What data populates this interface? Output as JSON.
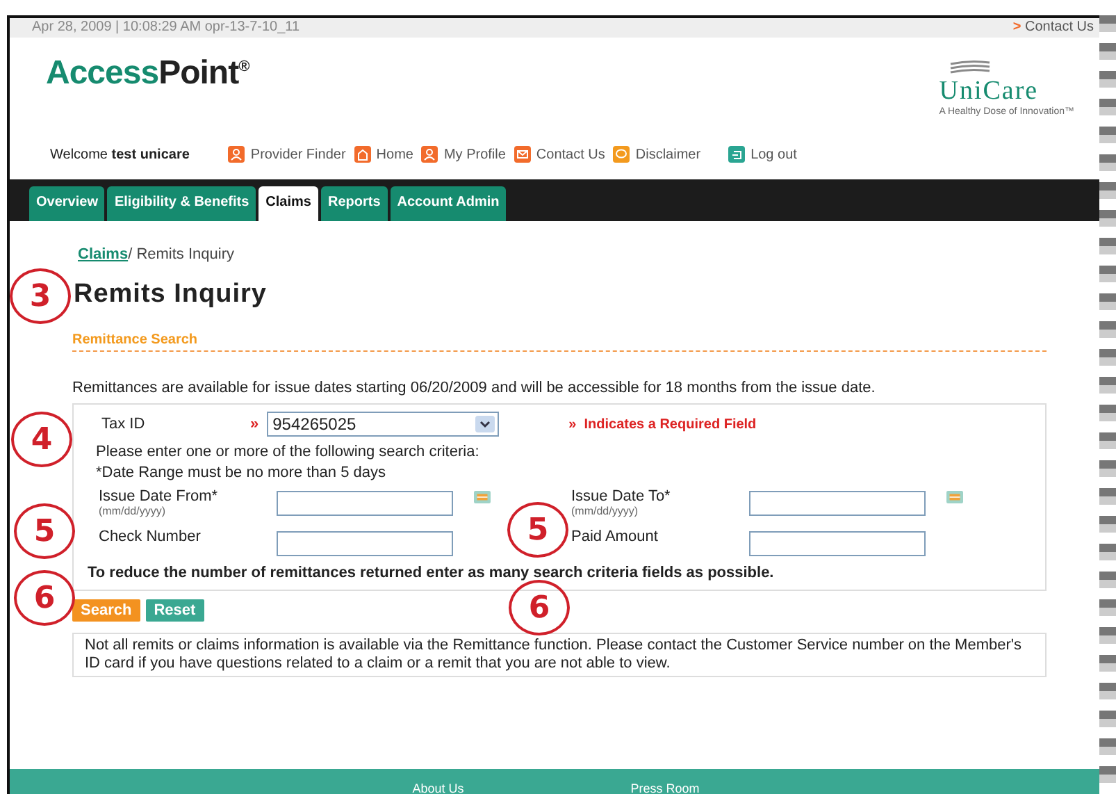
{
  "top_bar": {
    "timestamp": "Apr 28, 2009 | 10:08:29 AM opr-13-7-10_11",
    "contact_link": "Contact Us",
    "contact_arrow": ">"
  },
  "header": {
    "logo_first": "Access",
    "logo_second": "Point",
    "logo_mark": "®",
    "partner_logo": "UniCare",
    "partner_tagline": "A Healthy Dose of Innovation™"
  },
  "welcome": "Welcome **test unicare**",
  "user_links": [
    {
      "label": "Provider Finder",
      "kind": "person"
    },
    {
      "label": "Home",
      "kind": "home"
    },
    {
      "label": "My Profile",
      "kind": "person"
    },
    {
      "label": "Contact Us",
      "kind": "mail"
    },
    {
      "label": "Disclaimer",
      "kind": "bubble"
    },
    {
      "label": "Log out",
      "kind": "logout"
    }
  ],
  "tabs": [
    {
      "label": "Overview",
      "selected": false
    },
    {
      "label": "Eligibility & Benefits",
      "selected": false
    },
    {
      "label": "Claims",
      "selected": true
    },
    {
      "label": "Reports",
      "selected": false
    },
    {
      "label": "Account Admin",
      "selected": false
    }
  ],
  "breadcrumb": {
    "link": "Claims",
    "current": "/ Remits Inquiry"
  },
  "page_title": "Remits Inquiry",
  "section_title": "Remittance Search",
  "availability_note": "Remittances are available for issue dates starting 06/20/2009 and will be accessible for 18 months from the issue date.",
  "form": {
    "tax_id": {
      "label": "Tax ID",
      "required_mark": "»",
      "value": "954265025"
    },
    "required_legend": {
      "mark": "»",
      "text": "Indicates a Required Field"
    },
    "instructions": "Please enter one or more of the following search criteria:",
    "date_rule": "*Date Range must be no more than 5 days",
    "fields": [
      {
        "label": "Issue Date From*",
        "hint": "(mm/dd/yyyy)",
        "kind": "date"
      },
      {
        "label": "Issue Date To*",
        "hint": "(mm/dd/yyyy)",
        "kind": "date"
      },
      {
        "label": "Check Number",
        "kind": "text"
      },
      {
        "label": "Paid Amount",
        "kind": "text"
      }
    ],
    "tip": "To reduce the number of remittances returned enter as many search criteria fields as possible."
  },
  "buttons": [
    {
      "label": "Search",
      "kind": "primary"
    },
    {
      "label": "Reset",
      "kind": "secondary"
    }
  ],
  "disclaimer": "Not all remits or claims information is available via the Remittance function. Please contact the Customer Service number on the Member's ID card if you have questions related to a claim or a remit that you are not able to view.",
  "footer_links": [
    "About Us",
    "Press Room"
  ],
  "annotations": [
    "3",
    "4",
    "5",
    "5",
    "6",
    "6"
  ]
}
